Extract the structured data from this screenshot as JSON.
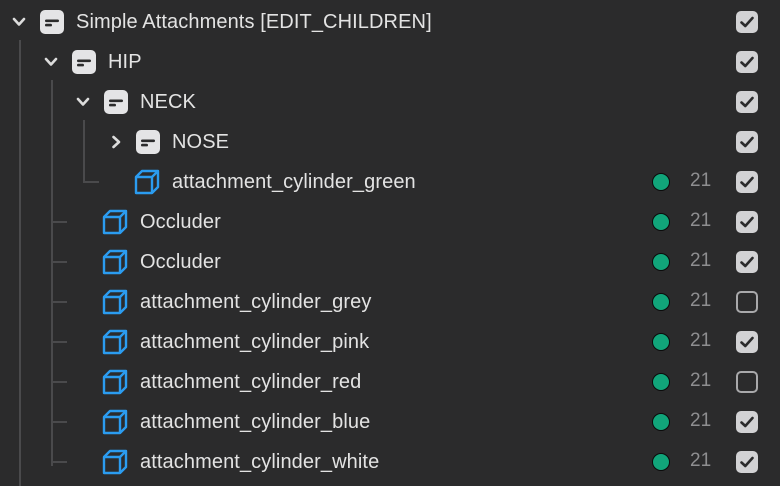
{
  "tree": {
    "rows": [
      {
        "label": "Simple Attachments [EDIT_CHILDREN]",
        "icon": "group-icon",
        "expander": "chevron-down-icon",
        "checked": true
      },
      {
        "label": "HIP",
        "icon": "group-icon",
        "expander": "chevron-down-icon",
        "checked": true
      },
      {
        "label": "NECK",
        "icon": "group-icon",
        "expander": "chevron-down-icon",
        "checked": true
      },
      {
        "label": "NOSE",
        "icon": "group-icon",
        "expander": "chevron-right-icon",
        "checked": true
      },
      {
        "label": "attachment_cylinder_green",
        "icon": "mesh-icon",
        "count": "21",
        "checked": true
      },
      {
        "label": "Occluder",
        "icon": "mesh-icon",
        "count": "21",
        "checked": true
      },
      {
        "label": "Occluder",
        "icon": "mesh-icon",
        "count": "21",
        "checked": true
      },
      {
        "label": "attachment_cylinder_grey",
        "icon": "mesh-icon",
        "count": "21",
        "checked": false
      },
      {
        "label": "attachment_cylinder_pink",
        "icon": "mesh-icon",
        "count": "21",
        "checked": true
      },
      {
        "label": "attachment_cylinder_red",
        "icon": "mesh-icon",
        "count": "21",
        "checked": false
      },
      {
        "label": "attachment_cylinder_blue",
        "icon": "mesh-icon",
        "count": "21",
        "checked": true
      },
      {
        "label": "attachment_cylinder_white",
        "icon": "mesh-icon",
        "count": "21",
        "checked": true
      }
    ]
  },
  "colors": {
    "background": "#2b2b2c",
    "text": "#e3e3e3",
    "mesh_icon": "#2b9cf0",
    "status_dot": "#11a57a",
    "count_text": "#8e8e90",
    "checkbox_on": "#d2d2d4"
  }
}
